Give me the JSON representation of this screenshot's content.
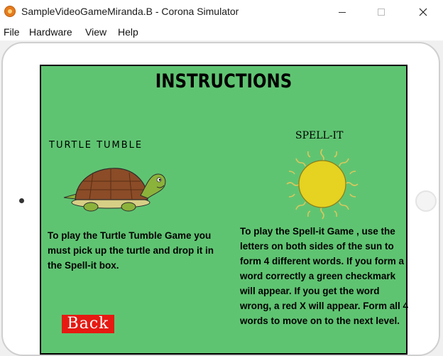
{
  "window": {
    "title": "SampleVideoGameMiranda.B - Corona Simulator",
    "app_icon": "corona-app-icon",
    "controls": [
      "minimize-icon",
      "maximize-icon",
      "close-icon"
    ]
  },
  "menubar": {
    "items": [
      "File",
      "Hardware",
      "View",
      "Help"
    ]
  },
  "screen": {
    "background_color": "#5fc472",
    "title": "INSTRUCTIONS",
    "turtle_game": {
      "name": "TURTLE TUMBLE",
      "image": "turtle-image",
      "instructions": "To play the Turtle Tumble Game you must pick up the turtle and drop it in the Spell-it box."
    },
    "spell_game": {
      "name": "SPELL-IT",
      "image": "sun-image",
      "instructions": "To play the Spell-it Game , use the letters on both sides of the sun to form 4 different words. If you form a word correctly a green checkmark will appear. If you get the word wrong, a red X will appear. Form all 4 words to move on to the next level."
    },
    "back_button": {
      "label": "Back",
      "color": "#e61a12"
    }
  }
}
